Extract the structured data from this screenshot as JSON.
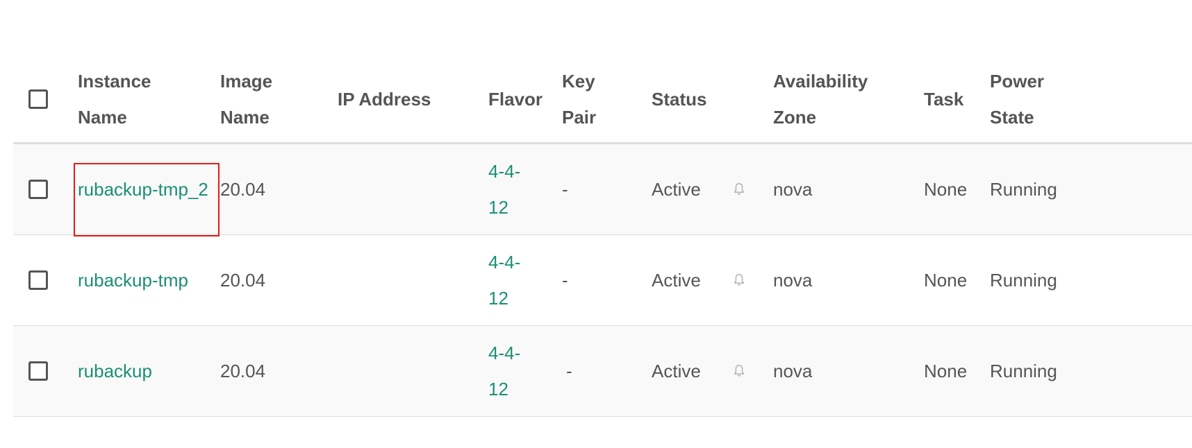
{
  "columns": {
    "select_all": "",
    "instance_name": "Instance Name",
    "image_name": "Image Name",
    "ip_address": "IP Address",
    "flavor": "Flavor",
    "key_pair": "Key Pair",
    "status": "Status",
    "availability_zone": "Availability Zone",
    "task": "Task",
    "power_state": "Power State"
  },
  "rows": [
    {
      "instance_name": "rubackup-tmp_2",
      "image_name": "20.04",
      "ip_address": "",
      "flavor": "4-4-12",
      "key_pair": "-",
      "status": "Active",
      "status_icon": "bell-icon",
      "availability_zone": "nova",
      "task": "None",
      "power_state": "Running"
    },
    {
      "instance_name": "rubackup-tmp",
      "image_name": "20.04",
      "ip_address": "",
      "flavor": "4-4-12",
      "key_pair": "-",
      "status": "Active",
      "status_icon": "bell-icon",
      "availability_zone": "nova",
      "task": "None",
      "power_state": "Running"
    },
    {
      "instance_name": "rubackup",
      "image_name": "20.04",
      "ip_address": "",
      "flavor": "4-4-12",
      "key_pair": "-",
      "status": "Active",
      "status_icon": "bell-icon",
      "availability_zone": "nova",
      "task": "None",
      "power_state": "Running"
    }
  ],
  "colors": {
    "link": "#1b8f73",
    "text": "#555555",
    "highlight": "#e31a1a",
    "row_alt": "#f9f9f9",
    "divider": "#dddddd"
  }
}
